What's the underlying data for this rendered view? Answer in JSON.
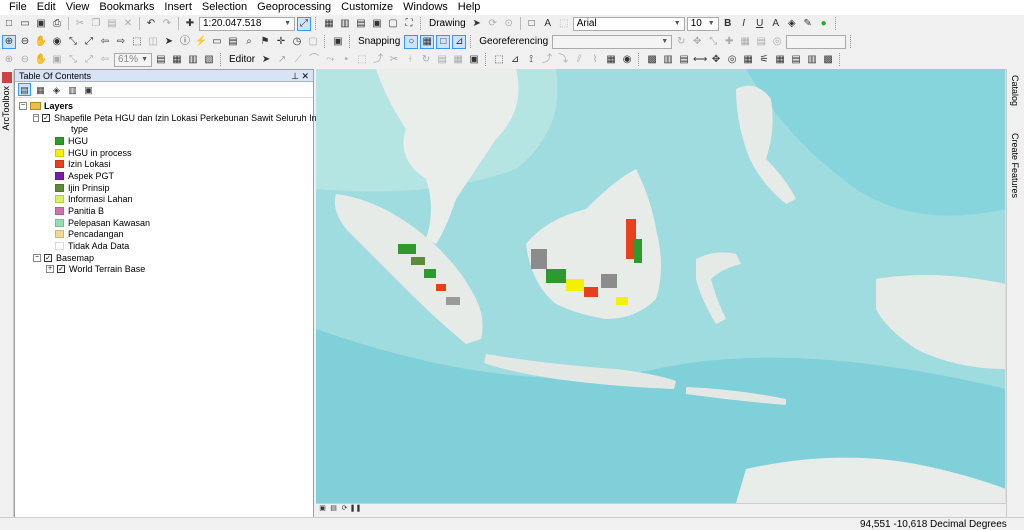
{
  "menu": [
    "File",
    "Edit",
    "View",
    "Bookmarks",
    "Insert",
    "Selection",
    "Geoprocessing",
    "Customize",
    "Windows",
    "Help"
  ],
  "toolbar": {
    "scale": "1:20.047.518",
    "drawing_label": "Drawing",
    "font_name": "Arial",
    "font_size": "10",
    "bold": "B",
    "italic": "I",
    "underline": "U",
    "zoom_percent": "61%",
    "editor_label": "Editor",
    "snapping_label": "Snapping",
    "georef_label": "Georeferencing"
  },
  "lefttab_label": "ArcToolbox",
  "toc": {
    "title": "Table Of Contents",
    "layers_label": "Layers",
    "shapefile_label": "Shapefile Peta HGU dan Izin Lokasi Perkebunan Sawit Seluruh Indonesia",
    "field_label": "type",
    "legend": [
      {
        "label": "HGU",
        "color": "#2e9a2e"
      },
      {
        "label": "HGU in process",
        "color": "#f2f200"
      },
      {
        "label": "Izin Lokasi",
        "color": "#e8401c"
      },
      {
        "label": "Aspek PGT",
        "color": "#7a1aa8"
      },
      {
        "label": "Ijin Prinsip",
        "color": "#5e8a3a"
      },
      {
        "label": "Informasi Lahan",
        "color": "#d8f060"
      },
      {
        "label": "Panitia B",
        "color": "#d070b0"
      },
      {
        "label": "Pelepasan Kawasan",
        "color": "#90e0b0"
      },
      {
        "label": "Pencadangan",
        "color": "#f4d890"
      },
      {
        "label": "Tidak Ada Data",
        "color": "#ffffff"
      }
    ],
    "basemap_label": "Basemap",
    "terrain_label": "World Terrain Base"
  },
  "right_tabs": [
    "Catalog",
    "Create Features"
  ],
  "status": {
    "coords": "94,551  -10,618 Decimal Degrees"
  }
}
